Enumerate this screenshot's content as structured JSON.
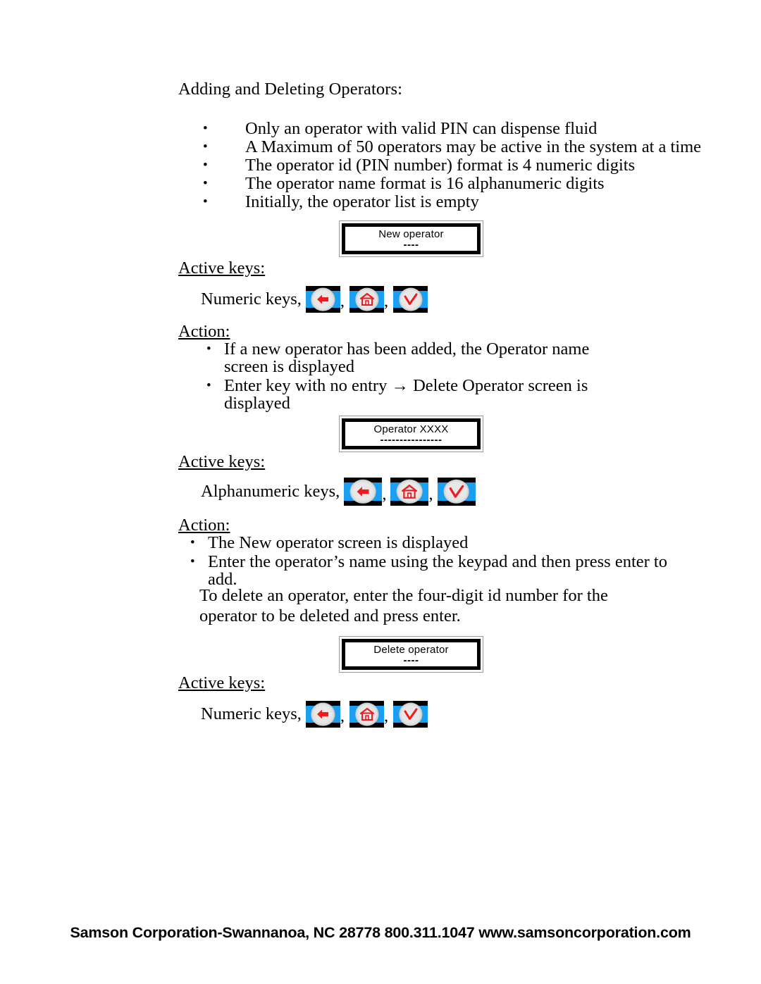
{
  "document": {
    "heading": "Adding and Deleting Operators:",
    "spec_bullets": [
      "Only an operator with valid PIN can dispense fluid",
      "A Maximum of 50 operators may be active in the system at a time",
      "The operator id (PIN number) format is 4 numeric digits",
      "The operator name format is 16 alphanumeric digits",
      "Initially, the operator list is empty"
    ],
    "section1": {
      "screen": {
        "line1": "New operator",
        "line2": "----"
      },
      "active_keys_label": "Active keys:",
      "keys_prefix": "Numeric keys,",
      "action_label": "Action:",
      "action_bullets": [
        "If a new operator has been added, the Operator name screen is displayed",
        "Enter key with no entry → Delete Operator screen is displayed"
      ]
    },
    "section2": {
      "screen": {
        "line1": "Operator XXXX",
        "line2": "----------------"
      },
      "active_keys_label": "Active keys:",
      "keys_prefix": "Alphanumeric keys,",
      "action_label": "Action:",
      "action_bullets": [
        "The New operator screen is displayed",
        "Enter the operator’s name using the keypad and then press enter to add."
      ],
      "paragraph": "To delete an operator, enter the four-digit id number for the operator to be deleted and press enter."
    },
    "section3": {
      "screen": {
        "line1": "Delete operator",
        "line2": "----"
      },
      "active_keys_label": "Active keys:",
      "keys_prefix": "Numeric keys,"
    },
    "separator": ",",
    "icons": {
      "back": "back-arrow-key-icon",
      "home": "home-key-icon",
      "enter": "enter-check-key-icon"
    },
    "colors": {
      "key_background": "#000000",
      "key_band": "#1b9ff0",
      "key_disc": "#e8e8e8",
      "key_glyph": "#ee1c20",
      "text": "#000000",
      "page": "#ffffff"
    },
    "footer": "Samson Corporation-Swannanoa, NC 28778  800.311.1047 www.samsoncorporation.com"
  }
}
